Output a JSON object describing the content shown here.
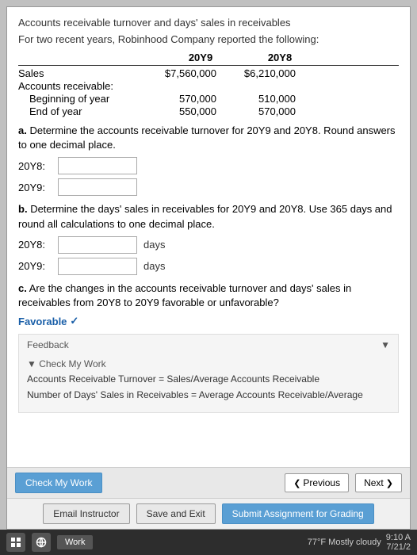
{
  "page": {
    "title": "Accounts receivable turnover and days' sales in receivables",
    "subtitle": "For two recent years, Robinhood Company reported the following:"
  },
  "table": {
    "col1": "",
    "col2": "20Y9",
    "col3": "20Y8",
    "rows": [
      {
        "label": "Sales",
        "val1": "$7,560,000",
        "val2": "$6,210,000",
        "indent": 0
      },
      {
        "label": "Accounts receivable:",
        "val1": "",
        "val2": "",
        "indent": 0
      },
      {
        "label": "Beginning of year",
        "val1": "570,000",
        "val2": "510,000",
        "indent": 1
      },
      {
        "label": "End of year",
        "val1": "550,000",
        "val2": "570,000",
        "indent": 1
      }
    ]
  },
  "question_a": {
    "label": "a.",
    "text": "Determine the accounts receivable turnover for 20Y9 and 20Y8. Round answers to one decimal place.",
    "inputs": [
      {
        "year": "20Y8:",
        "value": ""
      },
      {
        "year": "20Y9:",
        "value": ""
      }
    ]
  },
  "question_b": {
    "label": "b.",
    "text": "Determine the days' sales in receivables for 20Y9 and 20Y8. Use 365 days and round all calculations to one decimal place.",
    "inputs": [
      {
        "year": "20Y8:",
        "value": "",
        "unit": "days"
      },
      {
        "year": "20Y9:",
        "value": "",
        "unit": "days"
      }
    ]
  },
  "question_c": {
    "label": "c.",
    "text": "Are the changes in the accounts receivable turnover and days' sales in receivables from 20Y8 to 20Y9 favorable or unfavorable?",
    "answer": "Favorable",
    "checkmark": "✓"
  },
  "feedback": {
    "label": "Feedback",
    "arrow": "▼"
  },
  "check_my_work": {
    "header": "▼ Check My Work",
    "formula1": "Accounts Receivable Turnover = Sales/Average Accounts Receivable",
    "formula2": "Number of Days' Sales in Receivables = Average Accounts Receivable/Average"
  },
  "buttons": {
    "check_my_work": "Check My Work",
    "previous": "Previous",
    "next": "Next",
    "email_instructor": "Email Instructor",
    "save_and_exit": "Save and Exit",
    "submit": "Submit Assignment for Grading"
  },
  "taskbar": {
    "work_label": "Work",
    "weather": "77°F  Mostly cloudy",
    "time": "9:10 A",
    "date": "7/21/2"
  }
}
